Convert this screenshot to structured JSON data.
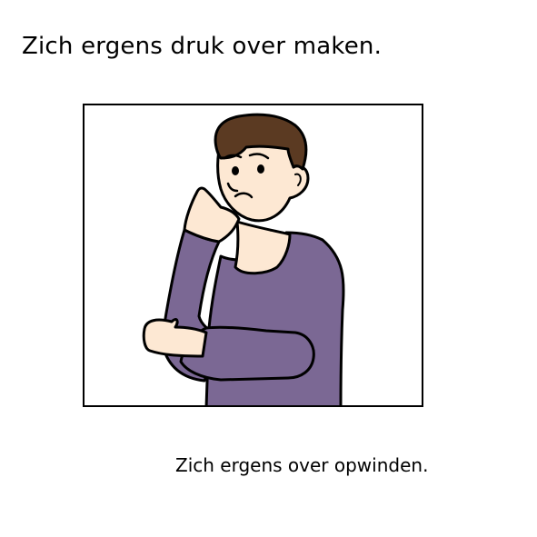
{
  "card": {
    "title": "Zich ergens druk over maken.",
    "caption": "Zich ergens over opwinden."
  },
  "illustration": {
    "subject": "worried-person-icon",
    "colors": {
      "sweater": "#7b6894",
      "skin": "#fde8d3",
      "hair": "#5b3a22",
      "outline": "#000000"
    }
  }
}
